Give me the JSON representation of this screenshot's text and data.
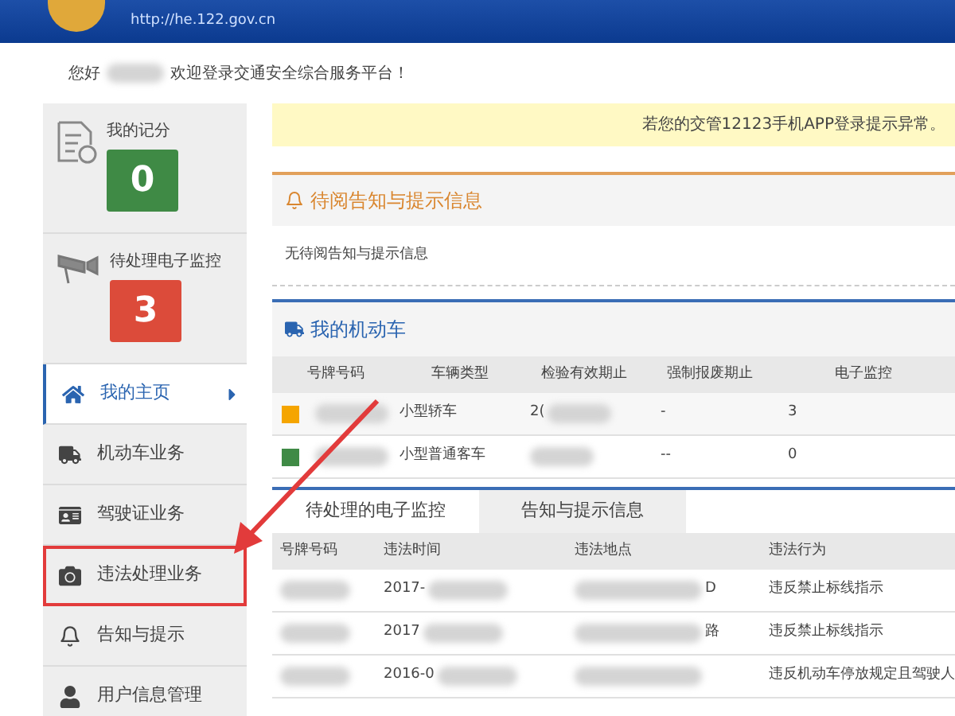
{
  "header": {
    "url": "http://he.122.gov.cn"
  },
  "greeting": {
    "before": "您好",
    "after": "欢迎登录交通安全综合服务平台！"
  },
  "stats": [
    {
      "label": "我的记分",
      "value": "0",
      "color": "#3f8a45"
    },
    {
      "label": "待处理电子监控",
      "value": "3",
      "color": "#dc4b3a"
    }
  ],
  "nav": [
    {
      "label": "我的主页",
      "selected": true,
      "highlighted": false
    },
    {
      "label": "机动车业务",
      "selected": false,
      "highlighted": false
    },
    {
      "label": "驾驶证业务",
      "selected": false,
      "highlighted": false
    },
    {
      "label": "违法处理业务",
      "selected": false,
      "highlighted": true
    },
    {
      "label": "告知与提示",
      "selected": false,
      "highlighted": false
    },
    {
      "label": "用户信息管理",
      "selected": false,
      "highlighted": false
    }
  ],
  "banner": "若您的交管12123手机APP登录提示异常。",
  "notices": {
    "title": "待阅告知与提示信息",
    "empty": "无待阅告知与提示信息"
  },
  "vehicles": {
    "title": "我的机动车",
    "columns": [
      "号牌号码",
      "车辆类型",
      "检验有效期止",
      "强制报废期止",
      "电子监控"
    ],
    "rows": [
      {
        "color": "#f5a500",
        "type": "小型轿车",
        "inspection": "2(",
        "scrap": "-",
        "monitor": "3"
      },
      {
        "color": "#3f8a45",
        "type": "小型普通客车",
        "inspection": "",
        "scrap": "--",
        "monitor": "0"
      }
    ]
  },
  "tabs": [
    {
      "label": "待处理的电子监控",
      "selected": true
    },
    {
      "label": "告知与提示信息",
      "selected": false
    }
  ],
  "violations": {
    "columns": [
      "号牌号码",
      "违法时间",
      "违法地点",
      "违法行为"
    ],
    "rows": [
      {
        "time": "2017-",
        "place": "D",
        "act": "违反禁止标线指示"
      },
      {
        "time": "2017",
        "place": "路",
        "act": "违反禁止标线指示"
      },
      {
        "time": "2016-0",
        "place": "",
        "act": "违反机动车停放规定且驾驶人"
      }
    ]
  }
}
